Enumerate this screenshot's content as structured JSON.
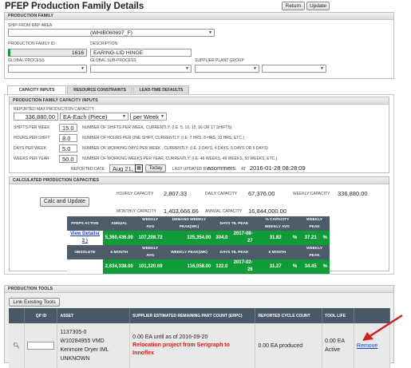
{
  "title": "PFEP Production Family Details",
  "buttons": {
    "return": "Return",
    "update": "Update"
  },
  "pf": {
    "header": "PRODUCTION FAMILY",
    "ship_label": "SHIP-FROM MRP AREA",
    "ship_value": "(WHIB060697_F)",
    "id_label": "PRODUCTION FAMILY ID",
    "id_value": "1616",
    "desc_label": "DESCRIPTION",
    "desc_value": "EARING-LID HINGE",
    "gp_label": "GLOBAL PROCESS",
    "gsp_label": "GLOBAL SUB-PROCESS",
    "spg_label": "SUPPLIER PLANT GROUP"
  },
  "tabs": [
    "CAPACITY INPUTS",
    "RESOURCE CONSTRAINTS",
    "LEAD-TIME DEFAULTS"
  ],
  "cap_inputs": {
    "header": "PRODUCTION FAMILY CAPACITY INPUTS",
    "rmc_label": "REPORTED MAX PRODUCTION CAPACITY",
    "rmc_value": "336,880.00",
    "uom": "EA-Each (Piece)",
    "per": "per Week",
    "rows": [
      {
        "label": "SHIFTS PER WEEK",
        "value": "15.0",
        "desc": "NUMBER OF SHIFTS PER WEEK, CURRENTLY: (I.E. 5, 10, 15, 16 OR 17 SHIFTS)"
      },
      {
        "label": "HOURS PER SHIFT",
        "value": "8.0",
        "desc": "NUMBER OF HOURS PER ONE SHIFT, CURRENTLY: (I.E. 7 HRS, 8 HRS, 10 HRS, ETC.)"
      },
      {
        "label": "DAYS PER WEEK",
        "value": "5.0",
        "desc": "NUMBER OF WORKING DAYS PER WEEK , CURRENTLY: (I.E. 3 DAYS, 4 DAYS, 5 DAYS OR 6 DAYS)"
      },
      {
        "label": "WEEKS PER YEAR",
        "value": "50.0",
        "desc": "NUMBER OF WORKING WEEKS PER YEAR, CURRENTLY: (I.E. 46 WEEKS, 48 WEEKS, 50 WEEKS, ETC.)"
      }
    ],
    "rep_date_label": "REPORTED DATE",
    "rep_date": "Aug 21, 2013",
    "today": "Today",
    "lub_label": "LAST UPDATED BY:",
    "lub_value": "asommers",
    "at_label": "AT",
    "at_value": "2016-01-28 08:28:09"
  },
  "calc": {
    "header": "CALCULATED PRODUCTION CAPACITIES",
    "button": "Calc and Update",
    "hourly_label": "HOURLY CAPACITY",
    "hourly": "2,807.33",
    "daily_label": "DAILY CAPACITY",
    "daily": "67,376.00",
    "weekly_label": "WEEKLY CAPACITY",
    "weekly": "336,880.00",
    "monthly_label": "MONTHLY CAPACITY",
    "monthly": "1,403,666.66",
    "annual_label": "ANNUAL CAPACITY",
    "annual": "16,844,000.00",
    "table": {
      "h1": [
        "ANNUAL",
        "WEEKLY AVG",
        "DEMAND WEEKLY PEAK(WK)",
        "DAYS TIL PEAK",
        "",
        "% CAPACITY WEEKLY AVG",
        "WEEKLY PEAK"
      ],
      "pfeps_active": "PFEPS ACTIVE",
      "view_details": "View Details( 2 )",
      "row1": [
        "5,360,436.00",
        "107,208.72",
        "125,354.00",
        "304.0",
        "2017-08-27",
        "31.82",
        "%",
        "37.21",
        "%"
      ],
      "obsolete": "OBSOLETE",
      "h2": [
        "6 MONTH",
        "WEEKLY AVG",
        "WEEKLY PEAK(WK)",
        "DAYS TIL PEAK",
        "",
        "6 MONTH",
        "WEEKLY PEAK"
      ],
      "row2": [
        "2,634,338.00",
        "101,320.69",
        "116,058.00",
        "122.0",
        "2017-02-26",
        "31.27",
        "%",
        "34.45",
        "%"
      ]
    }
  },
  "tools": {
    "header": "PRODUCTION TOOLS",
    "link_btn": "Link Existing Tools",
    "cols": [
      "QP ID",
      "ASSET",
      "SUPPLIER ESTIMATED REMAINING PART COUNT (ERPC)",
      "REPORTED CYCLE COUNT",
      "TOOL LIFE",
      ""
    ],
    "row": {
      "asset": [
        "1137305-0",
        "W10284955 VMD",
        "Kenmore Dryer IML",
        "UNKNOWN"
      ],
      "erpc": "0.00 EA  until  as of 2016-09-20",
      "note": "Relocation project from Serigraph to Innoflex",
      "rcc": "0.00 EA  produced",
      "life_value": "0.00 EA",
      "life_status": "Active",
      "remove": "Remove"
    }
  },
  "colors": {
    "green": "#0f9b38",
    "header_dark": "#4d5b6a",
    "red": "#d01c1c",
    "arrow": "#d42020"
  }
}
